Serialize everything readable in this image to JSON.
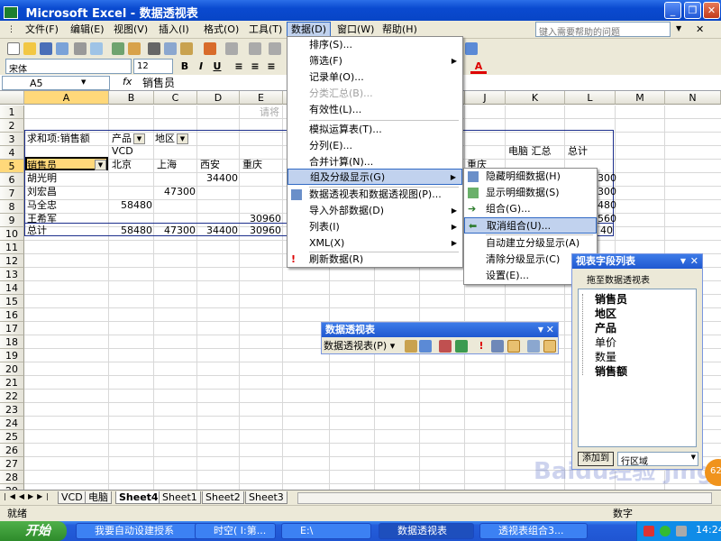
{
  "window": {
    "title": "Microsoft Excel - 数据透视表",
    "minimize_label": "_",
    "restore_label": "❐",
    "close_label": "✕"
  },
  "menubar": {
    "items": [
      "文件(F)",
      "编辑(E)",
      "视图(V)",
      "插入(I)",
      "格式(O)",
      "工具(T)",
      "数据(D)",
      "窗口(W)",
      "帮助(H)"
    ],
    "help_placeholder": "键入需要帮助的问题",
    "close_doc": "✕"
  },
  "toolbar": {
    "font": "宋体",
    "size": "12",
    "bold": "B",
    "italic": "I",
    "underline": "U",
    "font_color_label": "A"
  },
  "formula_bar": {
    "name_box": "A5",
    "fx": "fx",
    "content": "销售员"
  },
  "grid": {
    "columns": [
      "A",
      "B",
      "C",
      "D",
      "E",
      "F",
      "G",
      "H",
      "I",
      "J",
      "K",
      "L",
      "M",
      "N"
    ],
    "rows": [
      "1",
      "2",
      "3",
      "4",
      "5",
      "6",
      "7",
      "8",
      "9",
      "10",
      "11",
      "12",
      "13",
      "14",
      "15",
      "16",
      "17",
      "18",
      "19",
      "20",
      "21",
      "22",
      "23",
      "24",
      "25",
      "26",
      "27",
      "28",
      "29"
    ],
    "pivot_hint": "请将",
    "sum_label": "求和项:销售额",
    "field_product": "产品",
    "field_region": "地区",
    "vcd": "VCD",
    "salesperson": "销售员",
    "cities": [
      "北京",
      "上海",
      "西安",
      "重庆"
    ],
    "city_j": "重庆",
    "pc_total": "电脑 汇总",
    "total_label": "总计",
    "names": [
      "胡光明",
      "刘宏昌",
      "马全忠",
      "王希军",
      "总计"
    ],
    "values": {
      "d6": "34400",
      "c7": "47300",
      "b8": "58480",
      "e9": "30960",
      "b10": "58480",
      "c10": "47300",
      "d10": "34400",
      "e10": "30960"
    },
    "l_partial": [
      "300",
      "300",
      "480",
      "560",
      "40"
    ]
  },
  "data_menu": {
    "items": [
      "排序(S)...",
      "筛选(F)",
      "记录单(O)...",
      "分类汇总(B)...",
      "有效性(L)...",
      "模拟运算表(T)...",
      "分列(E)...",
      "合并计算(N)...",
      "组及分级显示(G)",
      "数据透视表和数据透视图(P)...",
      "导入外部数据(D)",
      "列表(I)",
      "XML(X)",
      "刷新数据(R)"
    ]
  },
  "group_submenu": {
    "items": [
      "隐藏明细数据(H)",
      "显示明细数据(S)",
      "组合(G)...",
      "取消组合(U)...",
      "自动建立分级显示(A)",
      "清除分级显示(C)",
      "设置(E)..."
    ]
  },
  "pivot_toolbar": {
    "title": "数据透视表",
    "menu_label": "数据透视表(P)"
  },
  "field_list": {
    "title": "视表字段列表",
    "subtitle": "拖至数据透视表",
    "fields": [
      "销售员",
      "地区",
      "产品",
      "单价",
      "数量",
      "销售额"
    ],
    "add_button": "添加到",
    "area": "行区域"
  },
  "sheet_tabs": [
    "VCD",
    "电脑",
    "Sheet4",
    "Sheet1",
    "Sheet2",
    "Sheet3"
  ],
  "status": {
    "ready": "就绪",
    "numlock": "数字"
  },
  "taskbar": {
    "start": "开始",
    "tasks": [
      "我要自动设建授系",
      "时空( I:第...",
      "E:\\",
      "数据透视表",
      "透视表组合3..."
    ],
    "clock": "14:24"
  },
  "watermark": "Baidu经验 jingyan.baidu.com"
}
